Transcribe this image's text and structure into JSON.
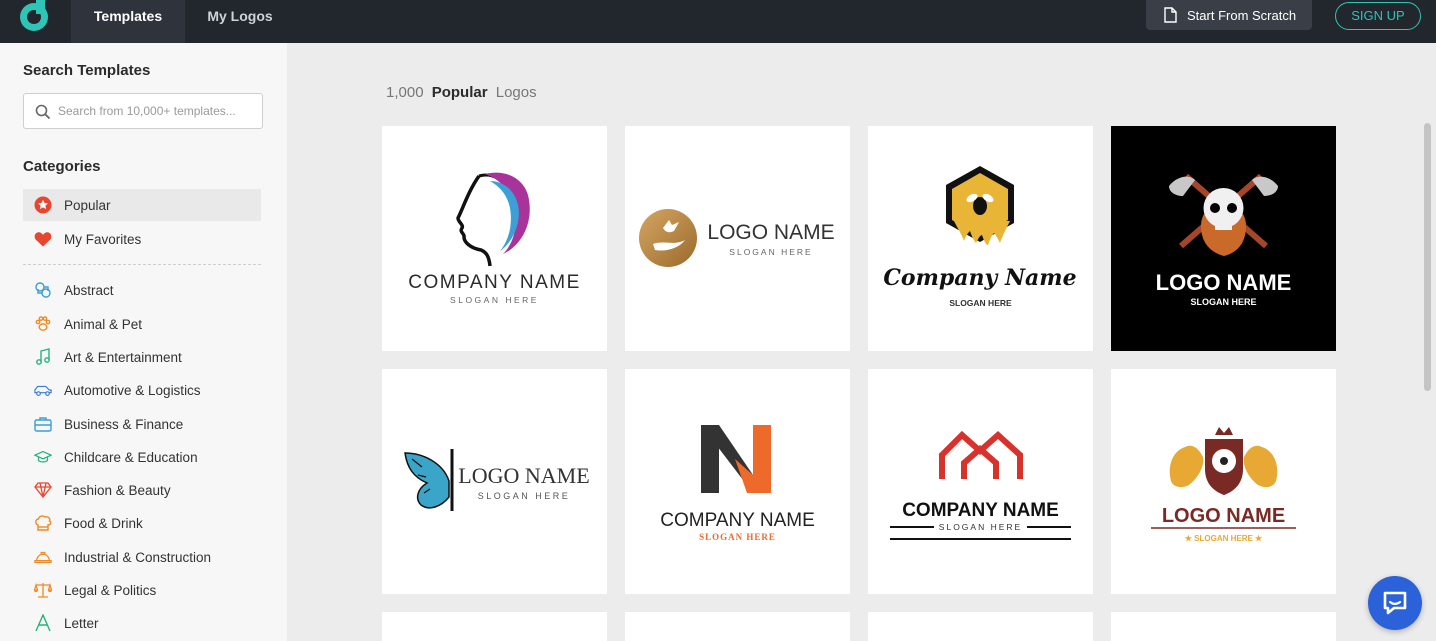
{
  "topbar": {
    "tabs": [
      {
        "label": "Templates",
        "active": true
      },
      {
        "label": "My Logos",
        "active": false
      }
    ],
    "start_scratch_label": "Start From Scratch",
    "signup_label": "SIGN UP",
    "accent_color": "#2ec4b6"
  },
  "sidebar": {
    "search_heading": "Search Templates",
    "search_placeholder": "Search from 10,000+ templates...",
    "categories_heading": "Categories",
    "pinned": [
      {
        "label": "Popular",
        "icon": "star-badge-icon",
        "active": true
      },
      {
        "label": "My Favorites",
        "icon": "heart-icon",
        "active": false
      }
    ],
    "categories": [
      {
        "label": "Abstract",
        "icon": "abstract-icon"
      },
      {
        "label": "Animal & Pet",
        "icon": "paw-icon"
      },
      {
        "label": "Art & Entertainment",
        "icon": "music-note-icon"
      },
      {
        "label": "Automotive & Logistics",
        "icon": "car-icon"
      },
      {
        "label": "Business & Finance",
        "icon": "briefcase-icon"
      },
      {
        "label": "Childcare & Education",
        "icon": "graduation-cap-icon"
      },
      {
        "label": "Fashion & Beauty",
        "icon": "diamond-icon"
      },
      {
        "label": "Food & Drink",
        "icon": "chef-hat-icon"
      },
      {
        "label": "Industrial & Construction",
        "icon": "hard-hat-icon"
      },
      {
        "label": "Legal & Politics",
        "icon": "scales-icon"
      },
      {
        "label": "Letter",
        "icon": "letter-a-icon"
      }
    ]
  },
  "main": {
    "count": "1,000",
    "count_bold": "Popular",
    "count_suffix": "Logos",
    "cards": [
      {
        "title": "COMPANY NAME",
        "slogan": "SLOGAN HERE"
      },
      {
        "title": "LOGO NAME",
        "slogan": "SLOGAN HERE"
      },
      {
        "title": "Company Name",
        "slogan": "SLOGAN HERE"
      },
      {
        "title": "LOGO NAME",
        "slogan": "SLOGAN HERE"
      },
      {
        "title": "LOGO NAME",
        "slogan": "SLOGAN HERE"
      },
      {
        "title": "COMPANY NAME",
        "slogan": "SLOGAN HERE"
      },
      {
        "title": "COMPANY NAME",
        "slogan": "SLOGAN HERE"
      },
      {
        "title": "LOGO NAME",
        "slogan": "★ SLOGAN HERE ★"
      }
    ]
  }
}
